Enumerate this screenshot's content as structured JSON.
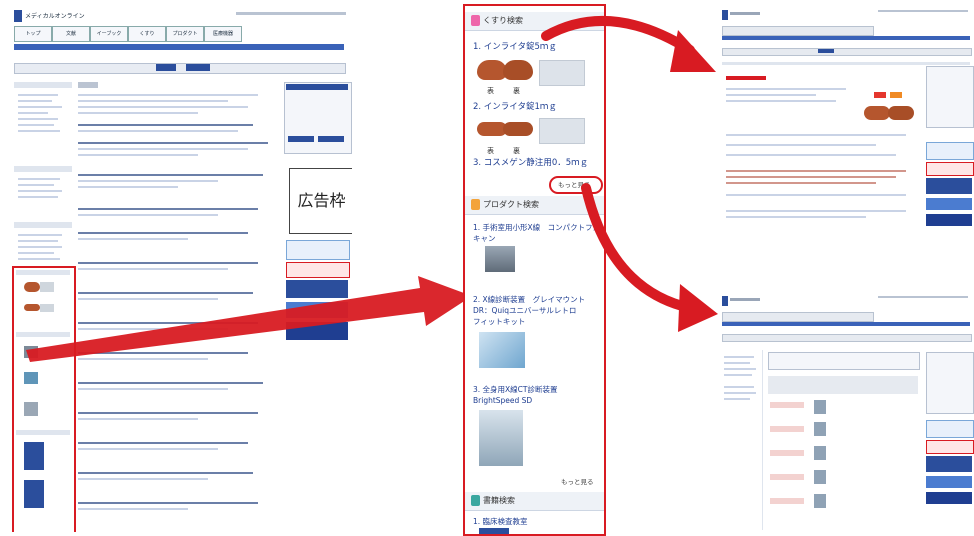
{
  "left_screenshot": {
    "ad_label": "広告枠",
    "logo_text": "メディカルオンライン",
    "tabs": [
      "トップ",
      "文献",
      "イーブック",
      "くすり",
      "プロダクト",
      "医療機器"
    ]
  },
  "panel": {
    "drug_section_title": "くすり検索",
    "drug_items": [
      "1. インライタ錠5ｍｇ",
      "2. インライタ錠1ｍｇ",
      "3. コスメゲン静注用0．5ｍｇ"
    ],
    "image_captions": [
      "表",
      "裏"
    ],
    "more_label": "もっと見る",
    "product_section_title": "プロダクト検索",
    "product_items": [
      "1. 手術室用小形X線　コンパクトフス\nキャン",
      "2. X線診断装置　グレイマウント\nDR：Quiqユニバーサルレトロ\nフィットキット",
      "3. 全身用X線CT診断装置\nBrightSpeed SD"
    ],
    "book_section_title": "書籍検索",
    "book_items": [
      "1. 臨床検査教室"
    ]
  },
  "colors": {
    "red": "#d81b22",
    "navy": "#2b4e9c",
    "link_blue": "#1f3e91",
    "pill_brown": "#b5562e"
  }
}
